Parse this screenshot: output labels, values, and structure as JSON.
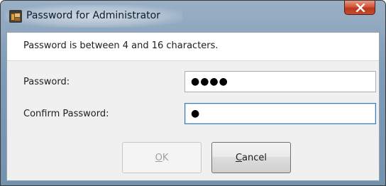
{
  "window": {
    "title": "Password for Administrator"
  },
  "info": {
    "message": "Password is between 4 and 16 characters."
  },
  "form": {
    "password_label": "Password:",
    "password_value": "●●●●",
    "confirm_label": "Confirm Password:",
    "confirm_value": "●"
  },
  "buttons": {
    "ok_mnemonic": "O",
    "ok_rest": "K",
    "cancel_mnemonic": "C",
    "cancel_rest": "ancel"
  },
  "colors": {
    "titlebar": "#7f9ab4",
    "close_button": "#c74a2c",
    "focus_border": "#3c7fb1"
  },
  "icons": {
    "app": "app-icon",
    "close": "close-icon"
  }
}
